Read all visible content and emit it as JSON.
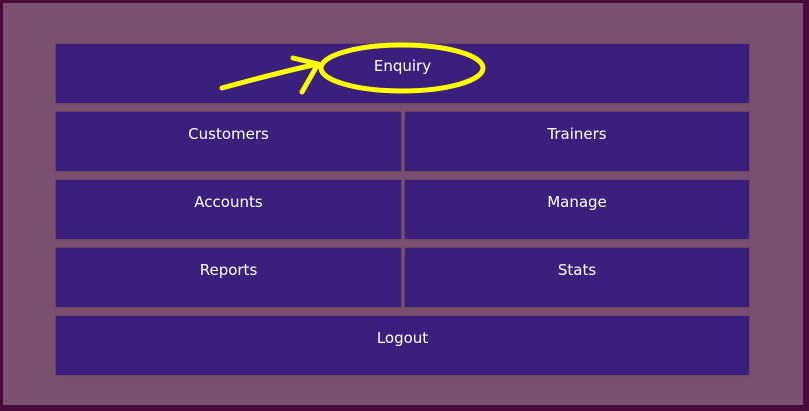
{
  "menu": {
    "enquiry": "Enquiry",
    "customers": "Customers",
    "trainers": "Trainers",
    "accounts": "Accounts",
    "manage": "Manage",
    "reports": "Reports",
    "stats": "Stats",
    "logout": "Logout"
  },
  "colors": {
    "background": "#7b4f70",
    "button": "#3a1f7c",
    "annotation": "#ffff00"
  }
}
